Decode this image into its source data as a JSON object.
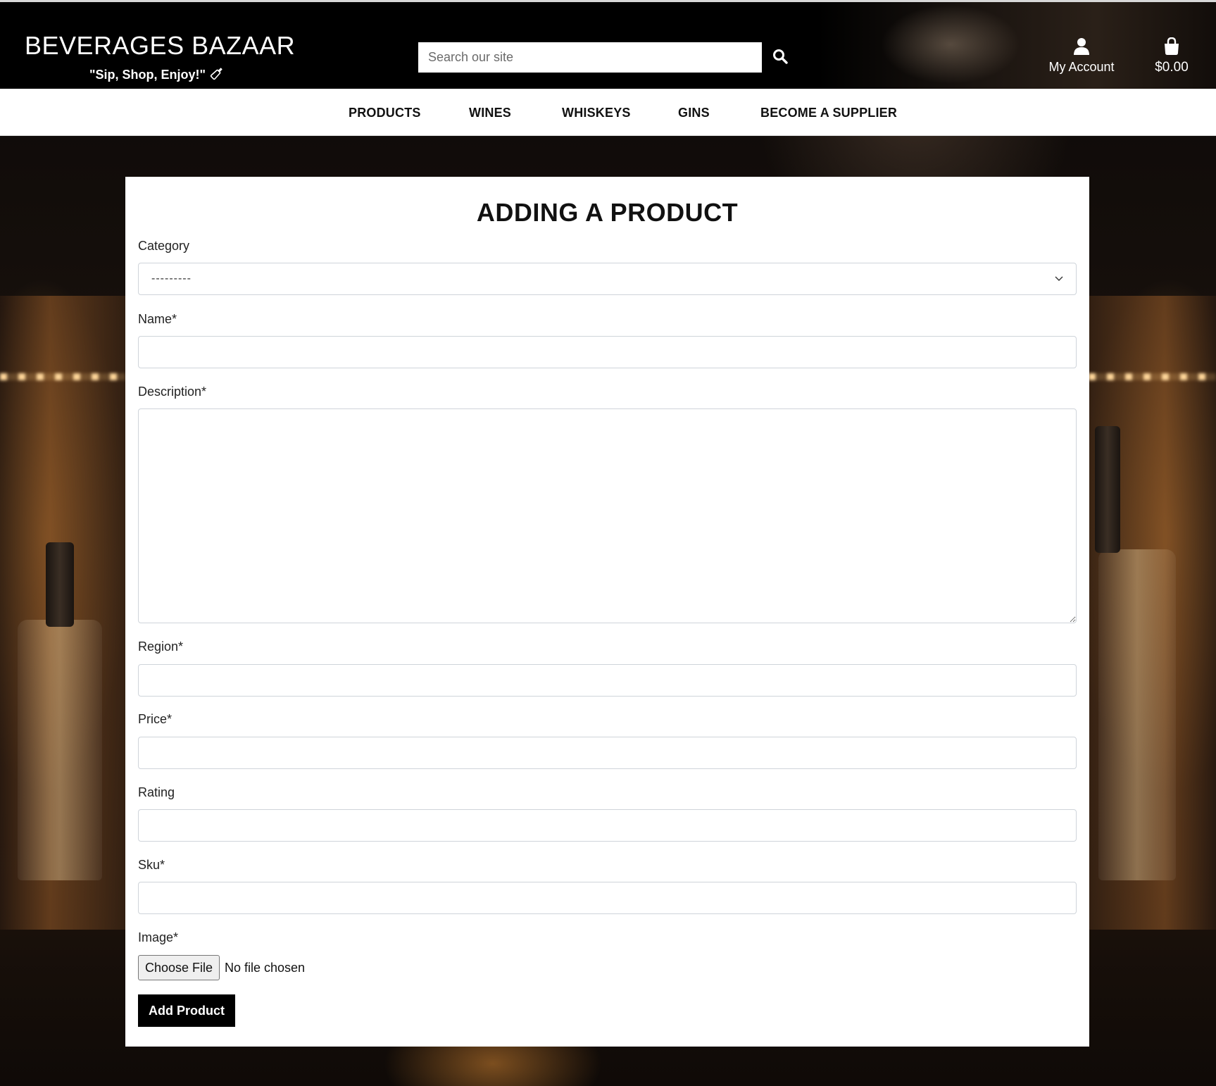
{
  "header": {
    "brand": "BEVERAGES BAZAAR",
    "tagline": "\"Sip, Shop, Enjoy!\"",
    "search_placeholder": "Search our site",
    "account_label": "My Account",
    "cart_total": "$0.00"
  },
  "nav": {
    "items": [
      "PRODUCTS",
      "WINES",
      "WHISKEYS",
      "GINS",
      "BECOME A SUPPLIER"
    ]
  },
  "form": {
    "title": "ADDING A PRODUCT",
    "category_label": "Category",
    "category_selected": "---------",
    "name_label": "Name*",
    "description_label": "Description*",
    "region_label": "Region*",
    "price_label": "Price*",
    "rating_label": "Rating",
    "sku_label": "Sku*",
    "image_label": "Image*",
    "file_button": "Choose File",
    "file_status": "No file chosen",
    "submit_label": "Add Product"
  },
  "icons": {
    "search": "search-icon",
    "account": "user-icon",
    "cart": "shopping-bag-icon",
    "tagline": "wine-bottle-icon",
    "select": "chevron-down-icon"
  },
  "colors": {
    "header_bg": "#000000",
    "nav_bg": "#ffffff",
    "button_bg": "#000000",
    "text": "#111111"
  }
}
